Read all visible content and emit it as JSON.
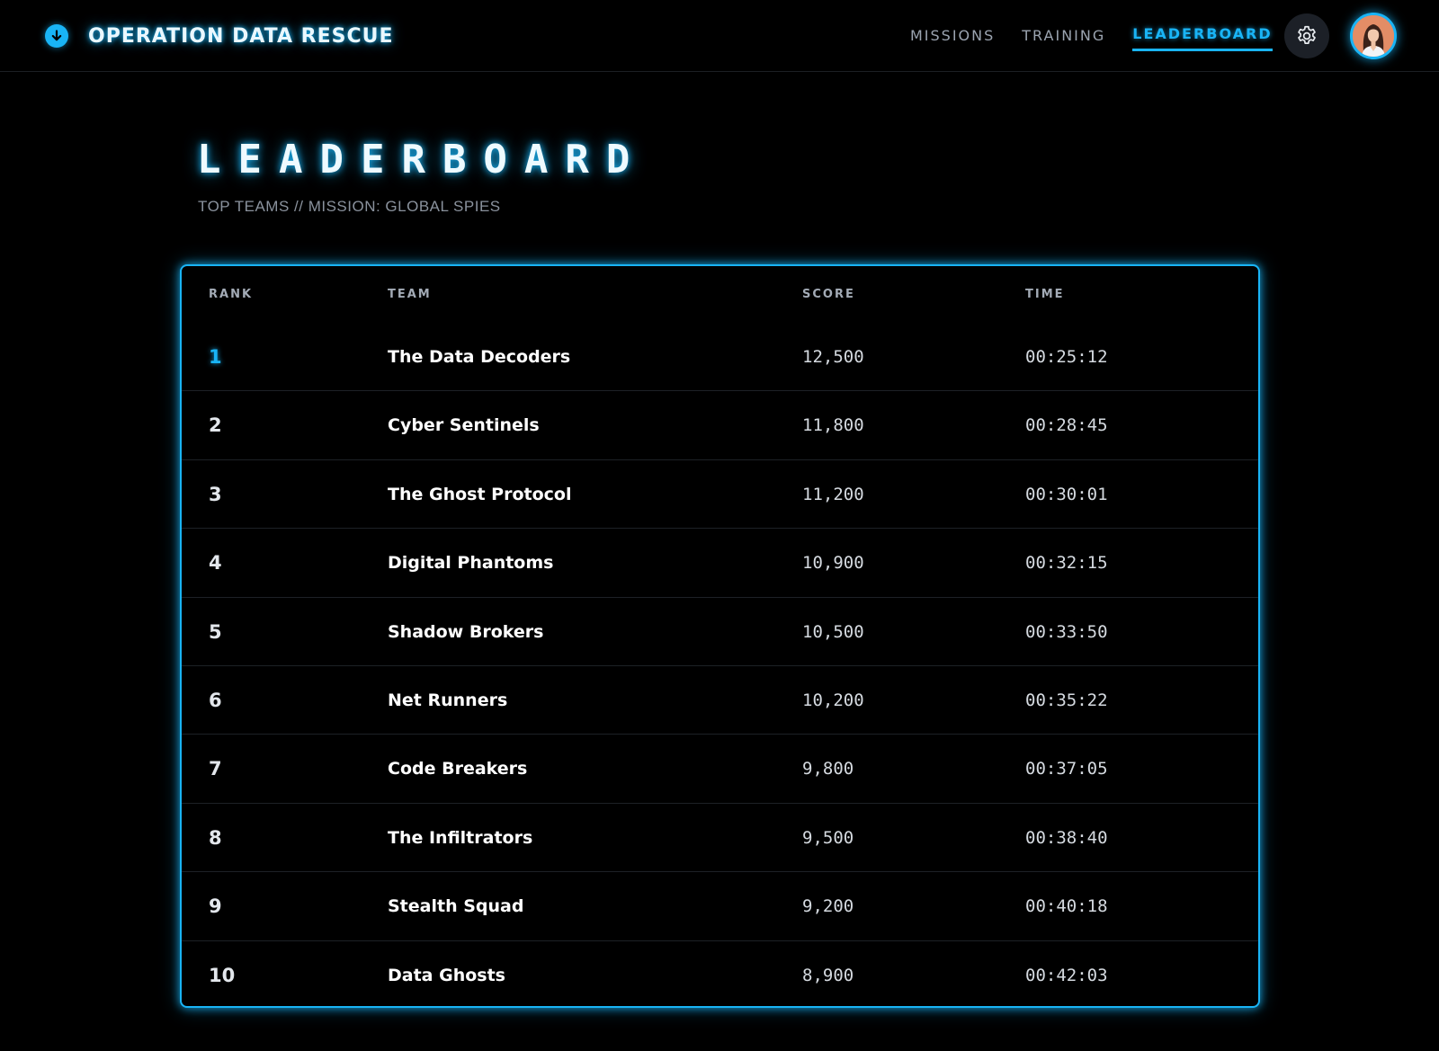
{
  "app": {
    "title": "OPERATION DATA RESCUE",
    "brand_icon": "arrow-down-circle-icon"
  },
  "nav": {
    "items": [
      {
        "label": "MISSIONS",
        "active": false
      },
      {
        "label": "TRAINING",
        "active": false
      },
      {
        "label": "LEADERBOARD",
        "active": true
      }
    ],
    "settings_icon": "gear-icon",
    "avatar_icon": "user-avatar"
  },
  "page": {
    "title": "LEADERBOARD",
    "subtitle": "TOP TEAMS // MISSION: GLOBAL SPIES"
  },
  "table": {
    "columns": [
      "RANK",
      "TEAM",
      "SCORE",
      "TIME"
    ],
    "rows": [
      {
        "rank": "1",
        "team": "The Data Decoders",
        "score": "12,500",
        "time": "00:25:12"
      },
      {
        "rank": "2",
        "team": "Cyber Sentinels",
        "score": "11,800",
        "time": "00:28:45"
      },
      {
        "rank": "3",
        "team": "The Ghost Protocol",
        "score": "11,200",
        "time": "00:30:01"
      },
      {
        "rank": "4",
        "team": "Digital Phantoms",
        "score": "10,900",
        "time": "00:32:15"
      },
      {
        "rank": "5",
        "team": "Shadow Brokers",
        "score": "10,500",
        "time": "00:33:50"
      },
      {
        "rank": "6",
        "team": "Net Runners",
        "score": "10,200",
        "time": "00:35:22"
      },
      {
        "rank": "7",
        "team": "Code Breakers",
        "score": "9,800",
        "time": "00:37:05"
      },
      {
        "rank": "8",
        "team": "The Infiltrators",
        "score": "9,500",
        "time": "00:38:40"
      },
      {
        "rank": "9",
        "team": "Stealth Squad",
        "score": "9,200",
        "time": "00:40:18"
      },
      {
        "rank": "10",
        "team": "Data Ghosts",
        "score": "8,900",
        "time": "00:42:03"
      }
    ]
  },
  "colors": {
    "accent": "#19b4f6",
    "background": "#000000",
    "muted_text": "#8a929d"
  }
}
